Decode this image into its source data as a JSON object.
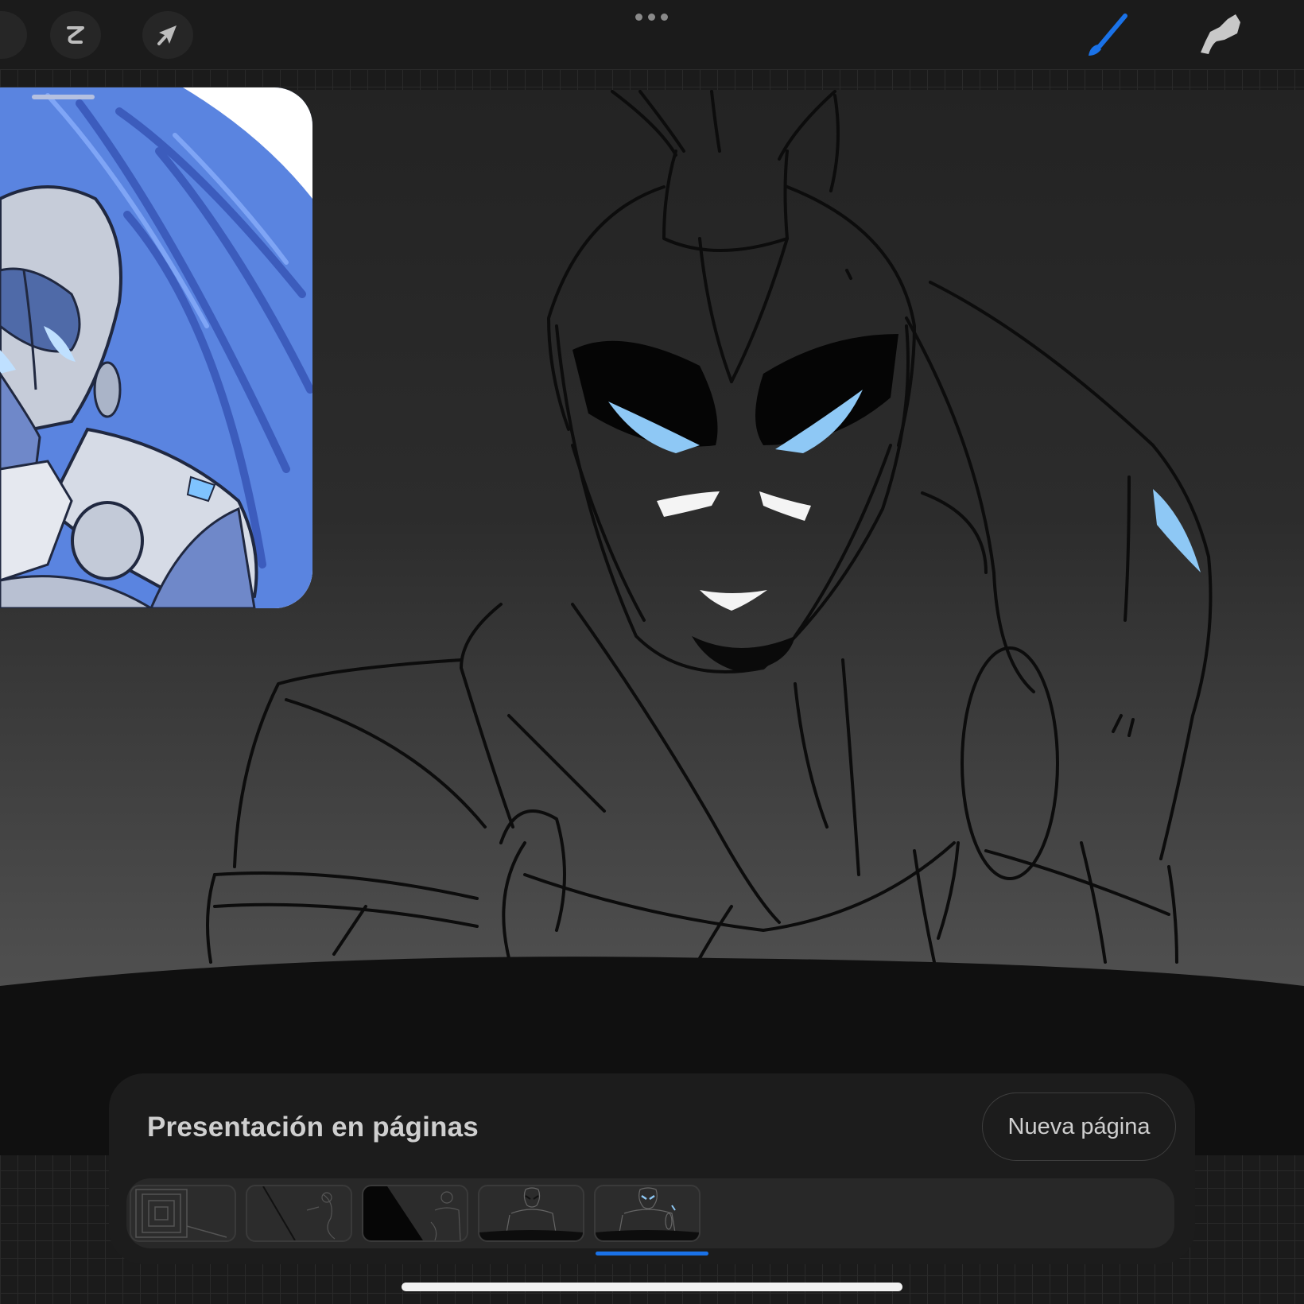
{
  "toolbar": {
    "left_tools": [
      {
        "name": "selection-tool",
        "icon": "s-curve-icon"
      },
      {
        "name": "transform-tool",
        "icon": "arrow-cursor-icon"
      }
    ],
    "more_menu_icon": "ellipsis-icon",
    "right_tools": [
      {
        "name": "brush-tool",
        "icon": "brush-icon",
        "active": true
      },
      {
        "name": "smudge-tool",
        "icon": "finger-icon",
        "active": false
      }
    ],
    "accent_color": "#1a72e8"
  },
  "reference_window": {
    "content": "blue-armored-character-reference"
  },
  "pages_panel": {
    "title": "Presentación en páginas",
    "new_page_label": "Nueva página",
    "pages": [
      {
        "thumbnail": "maze-sketch"
      },
      {
        "thumbnail": "line-sketch"
      },
      {
        "thumbnail": "dark-wedge-sketch"
      },
      {
        "thumbnail": "character-sketch"
      },
      {
        "thumbnail": "character-sketch-blue-eyes",
        "selected": true
      }
    ],
    "selected_index": 4
  }
}
